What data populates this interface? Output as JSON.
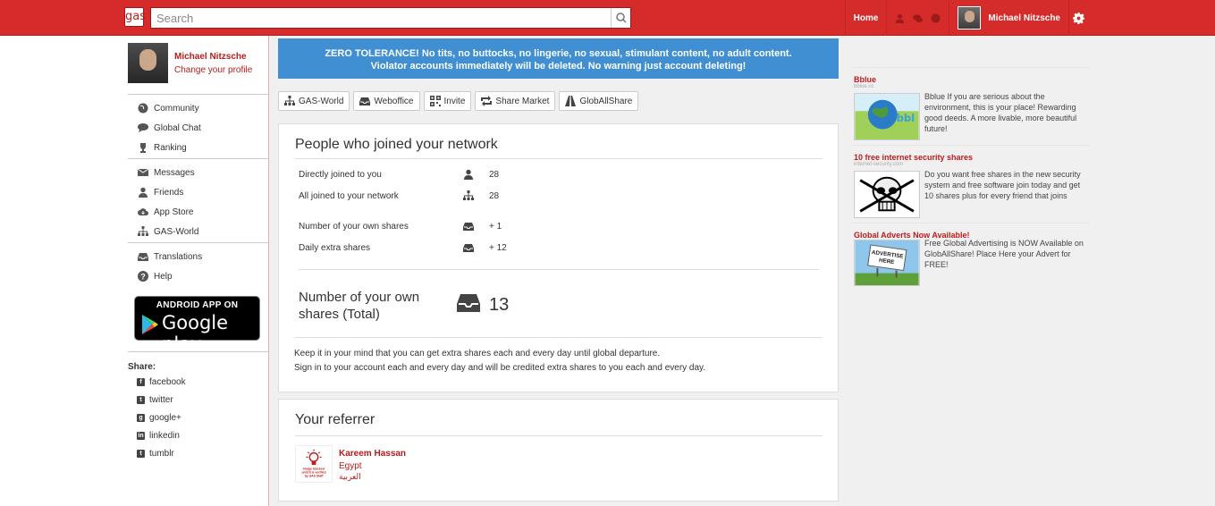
{
  "topbar": {
    "logo_text": "gas",
    "search_placeholder": "Search",
    "home_label": "Home",
    "user_name": "Michael Nitzsche",
    "icons": [
      "search-icon",
      "user-icon",
      "chat-icon",
      "globe-icon",
      "gear-icon"
    ]
  },
  "profile": {
    "name": "Michael Nitzsche",
    "change_label": "Change your profile"
  },
  "nav": {
    "group1": [
      {
        "label": "Community",
        "icon": "globe-icon"
      },
      {
        "label": "Global Chat",
        "icon": "chat-icon"
      },
      {
        "label": "Ranking",
        "icon": "trophy-icon"
      }
    ],
    "group2": [
      {
        "label": "Messages",
        "icon": "envelope-icon"
      },
      {
        "label": "Friends",
        "icon": "user-icon"
      },
      {
        "label": "App Store",
        "icon": "cloud-download-icon"
      },
      {
        "label": "GAS-World",
        "icon": "sitemap-icon"
      }
    ],
    "group3": [
      {
        "label": "Translations",
        "icon": "inbox-icon"
      },
      {
        "label": "Help",
        "icon": "question-icon"
      }
    ]
  },
  "play_badge": {
    "line1": "ANDROID APP ON",
    "line2": "Google play"
  },
  "share": {
    "label": "Share:",
    "items": [
      "facebook",
      "twitter",
      "google+",
      "linkedin",
      "tumblr"
    ]
  },
  "notice": {
    "line1": "ZERO TOLERANCE! No tits, no buttocks, no lingerie, no sexual, stimulant content, no adult content.",
    "line2": "Violator accounts immediately will be deleted. No warning just account deleting!",
    "color": "#3f8fd2"
  },
  "toolbar": [
    "GAS-World",
    "Weboffice",
    "Invite",
    "Share Market",
    "GlobAllShare"
  ],
  "network": {
    "title": "People who joined your network",
    "rows": [
      {
        "label": "Directly joined to you",
        "value": "28"
      },
      {
        "label": "All joined to your network",
        "value": "28"
      },
      {
        "label": "Number of your own shares",
        "value": "+ 1"
      },
      {
        "label": "Daily extra shares",
        "value": "+ 12"
      }
    ],
    "total_label": "Number of your own shares (Total)",
    "total_value": "13",
    "note1": "Keep it in your mind that you can get extra shares each and every day until global departure.",
    "note2": "Sign in to your account each and every day and will be credited extra shares to you each and every day."
  },
  "referrer": {
    "title": "Your referrer",
    "name": "Kareem Hassan",
    "country": "Egypt",
    "language": "العربية",
    "image_text": "Image blocked until it is verified by GAS Staff"
  },
  "ads": [
    {
      "title": "Bblue",
      "url": "bblue.cc",
      "text": "Bblue If you are serious about the environment, this is your place! Rewarding good deeds. A more livable, more beautiful future!"
    },
    {
      "title": "10 free internet security shares",
      "url": "internet-security.com",
      "text": "Do you want free shares in the new security system and free software join today and get 10 shares plus for every friend that joins"
    },
    {
      "title": "Global Adverts Now Available!",
      "url": "",
      "text": "Free Global Advertising is NOW Available on GlobAllShare! Place Here your Advert for FREE!"
    }
  ],
  "colors": {
    "brand_red": "#d62b2b",
    "link_red": "#b71c1c",
    "notice_blue": "#3f8fd2"
  }
}
